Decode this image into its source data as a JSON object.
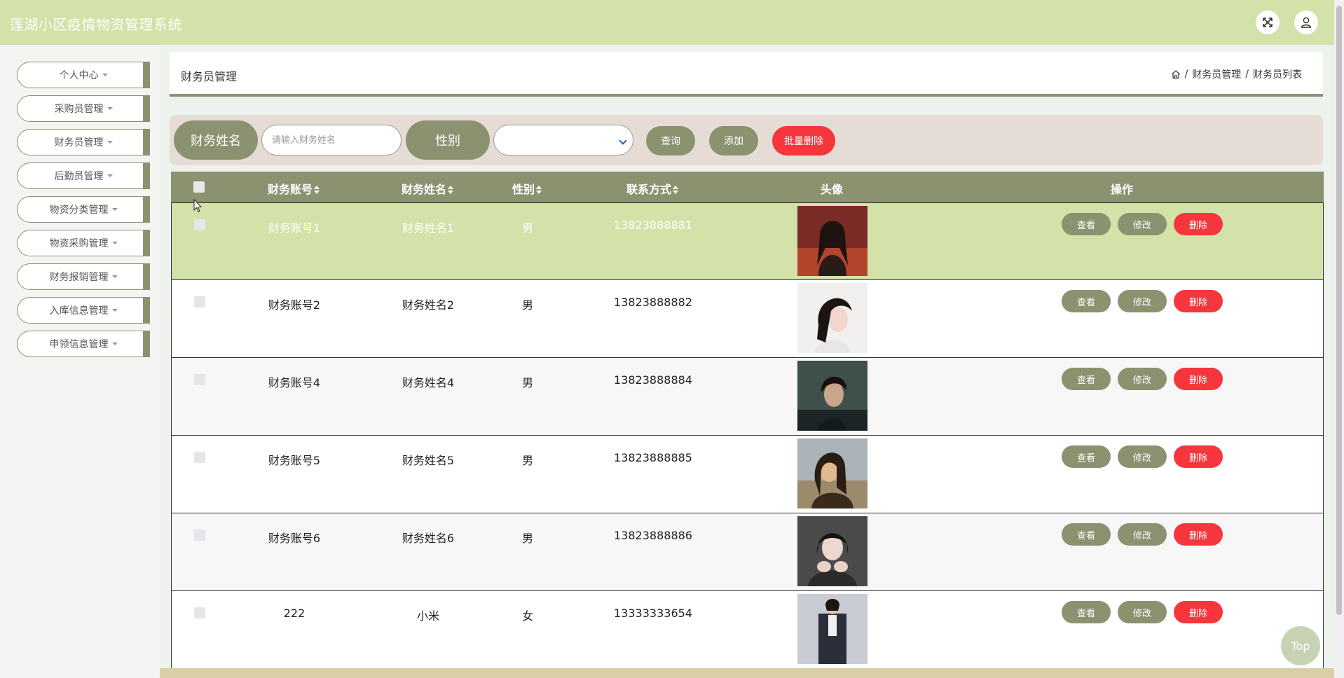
{
  "app": {
    "title": "莲湖小区疫情物资管理系统"
  },
  "header": {
    "fullscreen_icon": "fullscreen-icon",
    "user_icon": "user-icon"
  },
  "sidebar": {
    "items": [
      {
        "label": "个人中心"
      },
      {
        "label": "采购员管理"
      },
      {
        "label": "财务员管理"
      },
      {
        "label": "后勤员管理"
      },
      {
        "label": "物资分类管理"
      },
      {
        "label": "物资采购管理"
      },
      {
        "label": "财务报销管理"
      },
      {
        "label": "入库信息管理"
      },
      {
        "label": "申领信息管理"
      }
    ]
  },
  "page": {
    "title": "财务员管理",
    "breadcrumb": [
      "财务员管理",
      "财务员列表"
    ],
    "breadcrumb_separator": "/"
  },
  "search": {
    "name_label": "财务姓名",
    "name_placeholder": "请输入财务姓名",
    "name_value": "",
    "gender_label": "性别",
    "gender_value": "",
    "query_button": "查询",
    "add_button": "添加",
    "batch_delete_button": "批量删除"
  },
  "table": {
    "columns": {
      "account": "财务账号",
      "name": "财务姓名",
      "gender": "性别",
      "phone": "联系方式",
      "avatar": "头像",
      "actions": "操作"
    },
    "action_labels": {
      "view": "查看",
      "edit": "修改",
      "delete": "删除"
    },
    "rows": [
      {
        "account": "财务账号1",
        "name": "财务姓名1",
        "gender": "男",
        "phone": "13823888881"
      },
      {
        "account": "财务账号2",
        "name": "财务姓名2",
        "gender": "男",
        "phone": "13823888882"
      },
      {
        "account": "财务账号4",
        "name": "财务姓名4",
        "gender": "男",
        "phone": "13823888884"
      },
      {
        "account": "财务账号5",
        "name": "财务姓名5",
        "gender": "男",
        "phone": "13823888885"
      },
      {
        "account": "财务账号6",
        "name": "财务姓名6",
        "gender": "男",
        "phone": "13823888886"
      },
      {
        "account": "222",
        "name": "小米",
        "gender": "女",
        "phone": "13333333654"
      }
    ]
  },
  "top_button": "Top",
  "colors": {
    "header": "#d2e2a8",
    "accent": "#8a9270",
    "danger": "#f5363d"
  }
}
